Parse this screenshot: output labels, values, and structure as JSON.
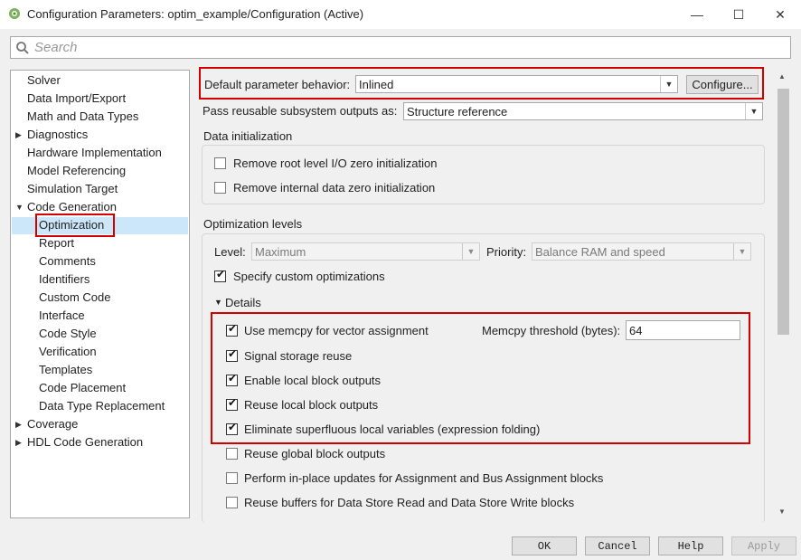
{
  "window": {
    "title": "Configuration Parameters: optim_example/Configuration (Active)",
    "minimize": "—",
    "maximize": "☐",
    "close": "✕"
  },
  "search": {
    "placeholder": "Search"
  },
  "tree": {
    "items": [
      {
        "label": "Solver"
      },
      {
        "label": "Data Import/Export"
      },
      {
        "label": "Math and Data Types"
      },
      {
        "label": "Diagnostics",
        "arrow": "▶"
      },
      {
        "label": "Hardware Implementation"
      },
      {
        "label": "Model Referencing"
      },
      {
        "label": "Simulation Target"
      },
      {
        "label": "Code Generation",
        "arrow": "▼"
      },
      {
        "label": "Optimization",
        "selected": true
      },
      {
        "label": "Report"
      },
      {
        "label": "Comments"
      },
      {
        "label": "Identifiers"
      },
      {
        "label": "Custom Code"
      },
      {
        "label": "Interface"
      },
      {
        "label": "Code Style"
      },
      {
        "label": "Verification"
      },
      {
        "label": "Templates"
      },
      {
        "label": "Code Placement"
      },
      {
        "label": "Data Type Replacement"
      },
      {
        "label": "Coverage",
        "arrow": "▶"
      },
      {
        "label": "HDL Code Generation",
        "arrow": "▶"
      }
    ]
  },
  "main": {
    "default_param_label": "Default parameter behavior:",
    "default_param_value": "Inlined",
    "configure_button": "Configure...",
    "pass_reusable_label": "Pass reusable subsystem outputs as:",
    "pass_reusable_value": "Structure reference",
    "data_init": {
      "header": "Data initialization",
      "remove_root": "Remove root level I/O zero initialization",
      "remove_internal": "Remove internal data zero initialization"
    },
    "opt_levels": {
      "header": "Optimization levels",
      "level_label": "Level:",
      "level_value": "Maximum",
      "priority_label": "Priority:",
      "priority_value": "Balance RAM and speed",
      "specify_custom": "Specify custom optimizations",
      "details": "Details"
    },
    "details": {
      "memcpy": "Use memcpy for vector assignment",
      "memcpy_threshold_label": "Memcpy threshold (bytes):",
      "memcpy_threshold_value": "64",
      "signal_storage": "Signal storage reuse",
      "enable_local": "Enable local block outputs",
      "reuse_local": "Reuse local block outputs",
      "eliminate": "Eliminate superfluous local variables (expression folding)",
      "reuse_global": "Reuse global block outputs",
      "inplace": "Perform in-place updates for Assignment and Bus Assignment blocks",
      "reuse_buffers": "Reuse buffers for Data Store Read and Data Store Write blocks"
    }
  },
  "footer": {
    "ok": "OK",
    "cancel": "Cancel",
    "help": "Help",
    "apply": "Apply"
  },
  "colors": {
    "highlight": "#d40000",
    "selection": "#cde7fa"
  }
}
